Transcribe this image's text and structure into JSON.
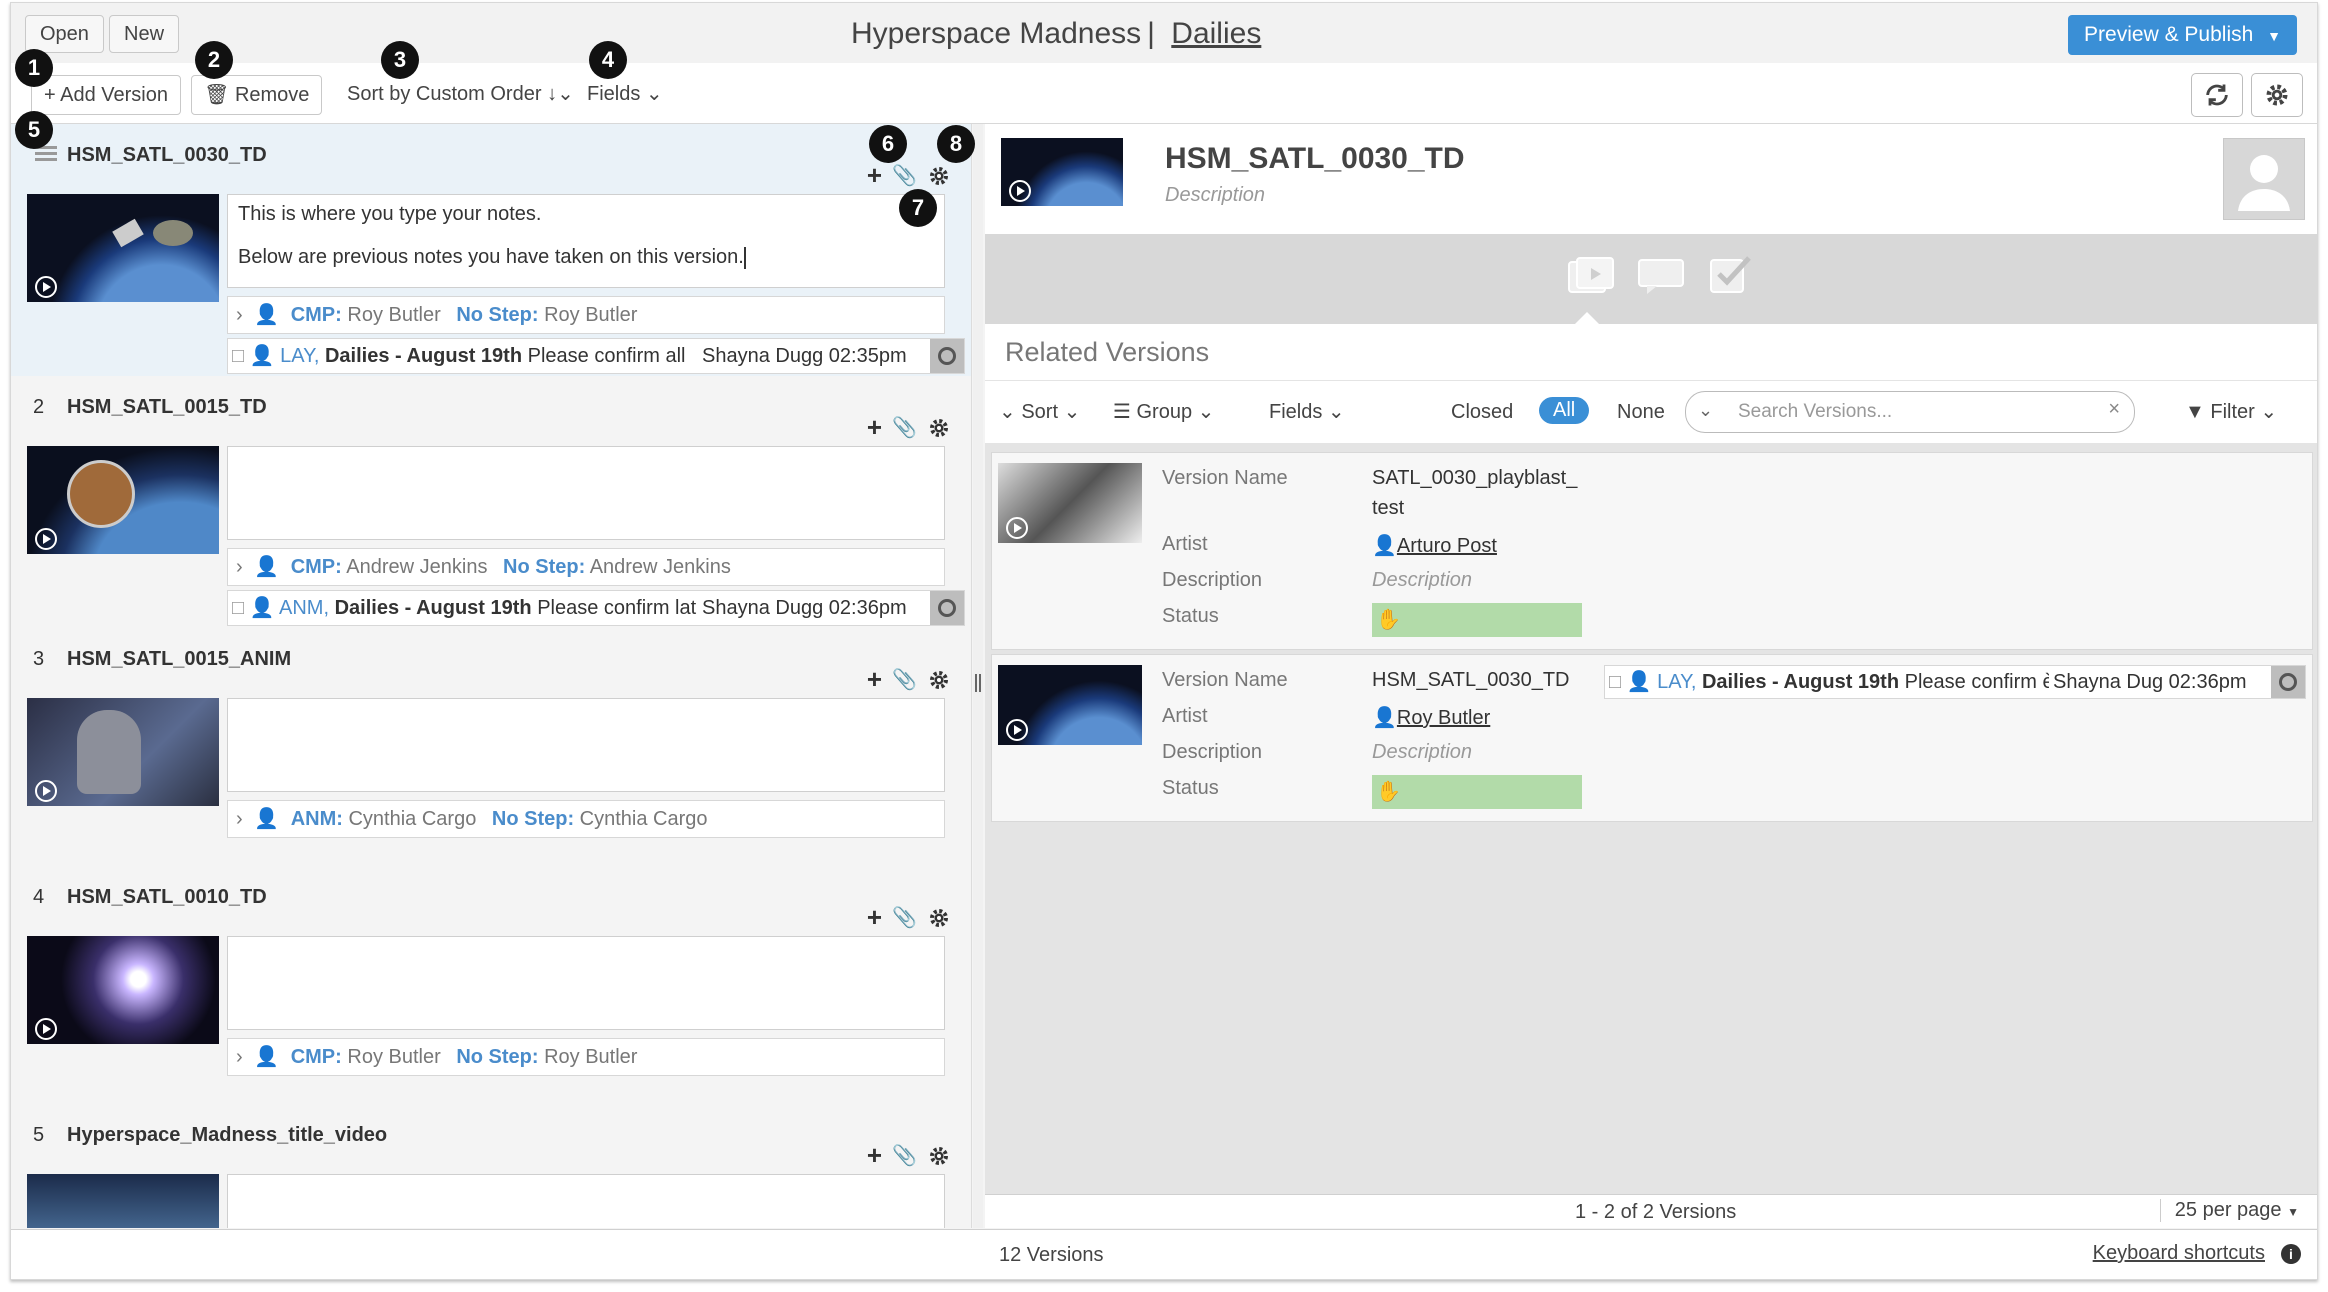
{
  "topbar": {
    "open_label": "Open",
    "new_label": "New",
    "project_title": "Hyperspace Madness",
    "title_separator": "|",
    "playlist_title": "Dailies",
    "publish_label": "Preview & Publish"
  },
  "toolbar": {
    "add_version_label": "+ Add Version",
    "remove_label": "Remove",
    "sort_label": "Sort by Custom Order",
    "fields_label": "Fields"
  },
  "callouts": [
    "1",
    "2",
    "3",
    "4",
    "5",
    "6",
    "7",
    "8"
  ],
  "versions": [
    {
      "number": "",
      "title": "HSM_SATL_0030_TD",
      "note_line1": "This is where you type your notes.",
      "note_line2": "Below are previous notes you have taken on this version.",
      "dept": "CMP:",
      "artist": "Roy Butler",
      "nostep": "No Step:",
      "nostep_artist": "Roy Butler",
      "has_note": true,
      "note_dept": "LAY,",
      "note_playlist": "Dailies - August 19th",
      "note_text": "Please confirm all",
      "note_author": "Shayna Dugg",
      "note_time": "02:35pm"
    },
    {
      "number": "2",
      "title": "HSM_SATL_0015_TD",
      "dept": "CMP:",
      "artist": "Andrew Jenkins",
      "nostep": "No Step:",
      "nostep_artist": "Andrew Jenkins",
      "has_note": true,
      "note_dept": "ANM,",
      "note_playlist": "Dailies - August 19th",
      "note_text": "Please confirm lat",
      "note_author": "Shayna Dugg",
      "note_time": "02:36pm"
    },
    {
      "number": "3",
      "title": "HSM_SATL_0015_ANIM",
      "dept": "ANM:",
      "artist": "Cynthia Cargo",
      "nostep": "No Step:",
      "nostep_artist": "Cynthia Cargo",
      "has_note": false
    },
    {
      "number": "4",
      "title": "HSM_SATL_0010_TD",
      "dept": "CMP:",
      "artist": "Roy Butler",
      "nostep": "No Step:",
      "nostep_artist": "Roy Butler",
      "has_note": false
    },
    {
      "number": "5",
      "title": "Hyperspace_Madness_title_video",
      "has_note": false
    }
  ],
  "detail": {
    "title": "HSM_SATL_0030_TD",
    "description_placeholder": "Description",
    "related_title": "Related Versions",
    "sort_label": "Sort",
    "group_label": "Group",
    "fields_label": "Fields",
    "filter_closed": "Closed",
    "filter_all": "All",
    "filter_none": "None",
    "search_placeholder": "Search Versions...",
    "filter_label": "Filter",
    "pagination": "1 - 2 of 2 Versions",
    "per_page": "25 per page"
  },
  "related": [
    {
      "version_name_label": "Version Name",
      "version_name_l1": "SATL_0030_playblast_",
      "version_name_l2": "test",
      "artist_label": "Artist",
      "artist": "Arturo Post",
      "description_label": "Description",
      "description": "Description",
      "status_label": "Status"
    },
    {
      "version_name_label": "Version Name",
      "version_name_l1": "HSM_SATL_0030_TD",
      "artist_label": "Artist",
      "artist": "Roy Butler",
      "description_label": "Description",
      "description": "Description",
      "status_label": "Status",
      "note_dept": "LAY,",
      "note_playlist": "Dailies - August 19th",
      "note_text": "Please confirm è",
      "note_author": "Shayna Dug",
      "note_time": "02:36pm"
    }
  ],
  "footer": {
    "version_count": "12 Versions",
    "keyboard_shortcuts": "Keyboard shortcuts"
  },
  "colors": {
    "accent": "#3a8fd6",
    "dept_blue": "#4a8ccb",
    "status_green": "#b2dba9"
  }
}
